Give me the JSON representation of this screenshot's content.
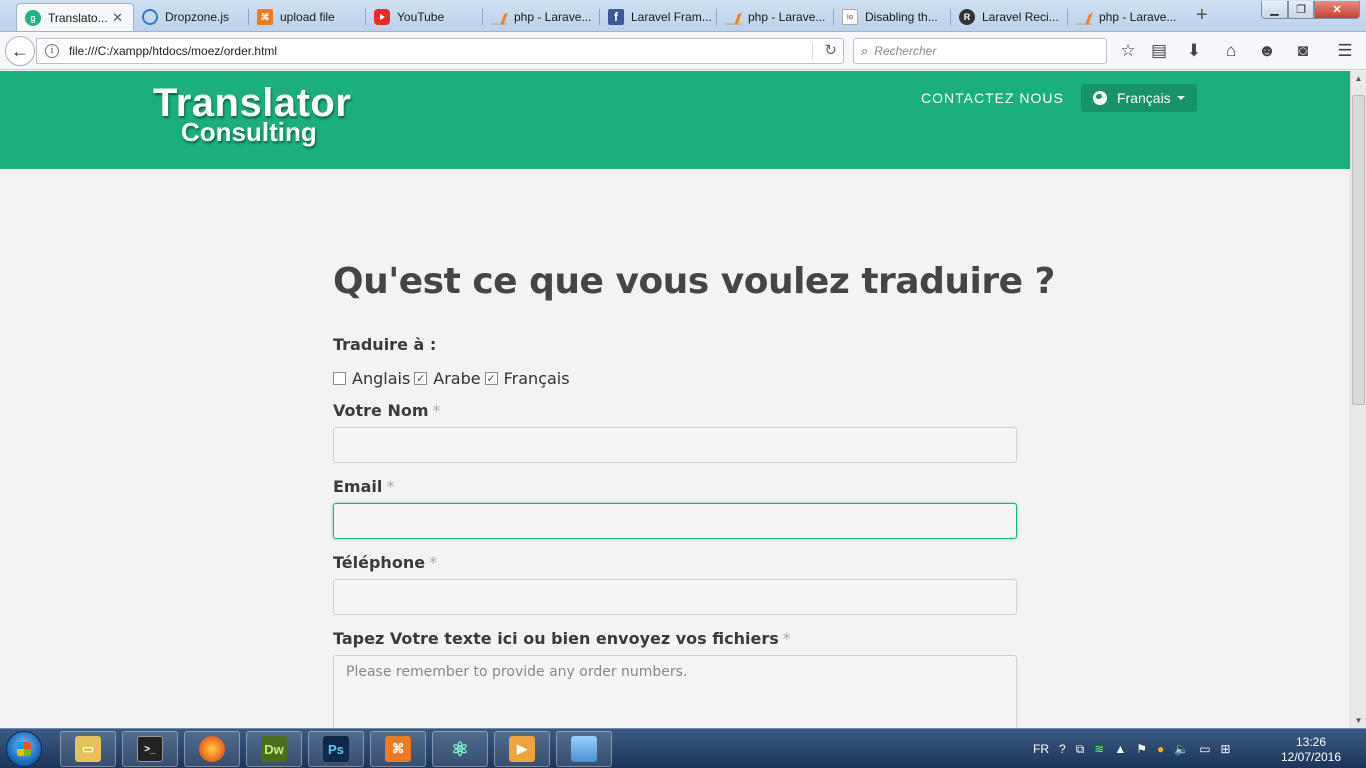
{
  "browser": {
    "tabs": [
      {
        "title": "Translato...",
        "icon": "grammarly-icon",
        "active": true
      },
      {
        "title": "Dropzone.js",
        "icon": "dropzone-icon"
      },
      {
        "title": "upload file",
        "icon": "xampp-icon"
      },
      {
        "title": "YouTube",
        "icon": "youtube-icon"
      },
      {
        "title": "php - Larave...",
        "icon": "stackoverflow-icon"
      },
      {
        "title": "Laravel Fram...",
        "icon": "facebook-icon"
      },
      {
        "title": "php - Larave...",
        "icon": "stackoverflow-icon"
      },
      {
        "title": "Disabling th...",
        "icon": "page-icon"
      },
      {
        "title": "Laravel Reci...",
        "icon": "laravel-recipes-icon"
      },
      {
        "title": "php - Larave...",
        "icon": "stackoverflow-icon"
      }
    ],
    "url": "file:///C:/xampp/htdocs/moez/order.html",
    "search_placeholder": "Rechercher"
  },
  "site": {
    "logo_line1": "Translator",
    "logo_line2": "Consulting",
    "nav_contact": "CONTACTEZ NOUS",
    "language": "Français",
    "accent_color": "#1aaf7c"
  },
  "form": {
    "title": "Qu'est ce que vous voulez traduire ?",
    "translate_to_label": "Traduire à :",
    "languages": [
      {
        "label": "Anglais",
        "checked": false
      },
      {
        "label": "Arabe",
        "checked": true
      },
      {
        "label": "Français",
        "checked": true
      }
    ],
    "name_label": "Votre Nom",
    "email_label": "Email",
    "phone_label": "Téléphone",
    "text_label": "Tapez Votre texte ici ou bien envoyez vos fichiers",
    "text_placeholder": "Please remember to provide any order numbers.",
    "required_mark": "*"
  },
  "taskbar": {
    "apps": [
      "explorer-icon",
      "terminal-icon",
      "firefox-icon",
      "dreamweaver-icon",
      "photoshop-icon",
      "xampp-icon",
      "atom-icon",
      "media-player-icon",
      "photo-viewer-icon"
    ],
    "dw_label": "Dw",
    "ps_label": "Ps",
    "language_indicator": "FR",
    "time": "13:26",
    "date": "12/07/2016"
  }
}
